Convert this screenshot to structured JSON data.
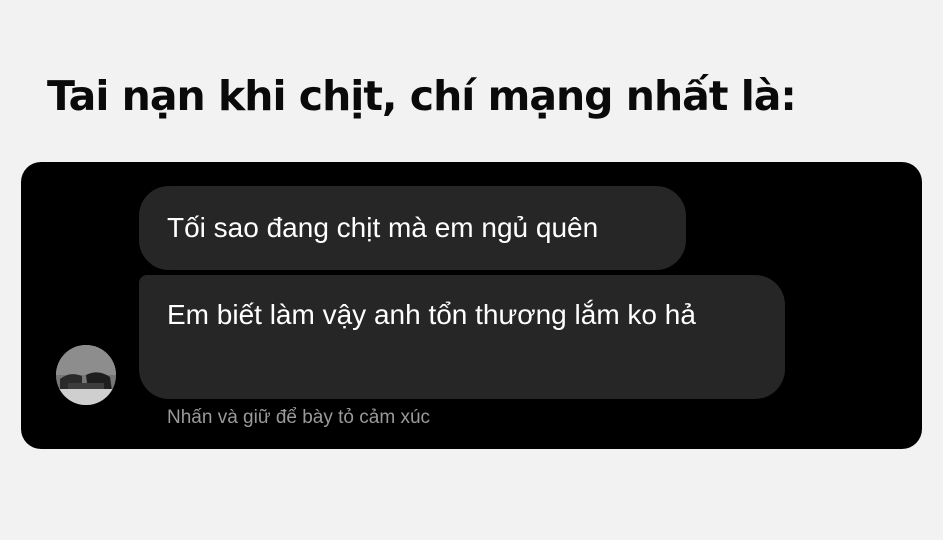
{
  "title": "Tai nạn khi chịt, chí mạng nhất là:",
  "chat": {
    "messages": [
      {
        "text": "Tối sao đang chịt mà em ngủ quên"
      },
      {
        "text": "Em biết làm vậy anh tổn thương lắm ko hả"
      }
    ],
    "reaction_hint": "Nhấn và giữ để bày tỏ cảm xúc",
    "avatar_icon": "profile-photo-icon"
  },
  "colors": {
    "page_background": "#f2f2f2",
    "chat_background": "#000000",
    "bubble_background": "#262626",
    "bubble_text": "#ffffff",
    "hint_text": "#9a9a9a"
  }
}
